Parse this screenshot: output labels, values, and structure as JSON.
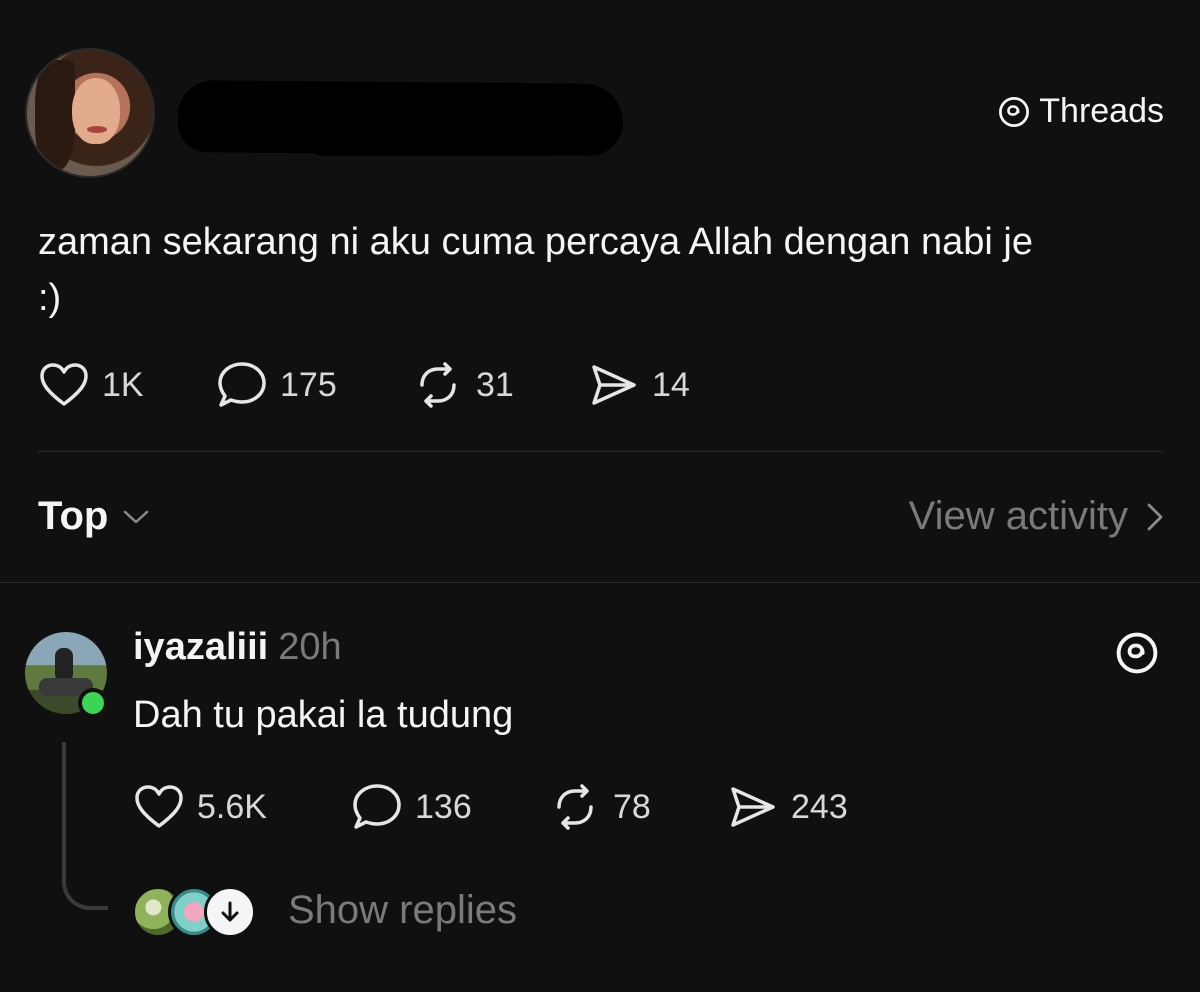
{
  "brand": {
    "label": "Threads"
  },
  "post": {
    "text_line1": "zaman sekarang ni aku cuma percaya Allah dengan nabi je",
    "text_line2": ":)",
    "stats": {
      "likes": "1K",
      "comments": "175",
      "reposts": "31",
      "shares": "14"
    }
  },
  "sort": {
    "label": "Top"
  },
  "activity": {
    "label": "View activity"
  },
  "reply": {
    "username": "iyazaliii",
    "time": "20h",
    "text": "Dah tu pakai la tudung",
    "stats": {
      "likes": "5.6K",
      "comments": "136",
      "reposts": "78",
      "shares": "243"
    },
    "show_replies": "Show replies"
  },
  "colors": {
    "background": "#101010",
    "text": "#f3f5f7",
    "muted": "#7a7a7a",
    "online": "#3bd454"
  }
}
